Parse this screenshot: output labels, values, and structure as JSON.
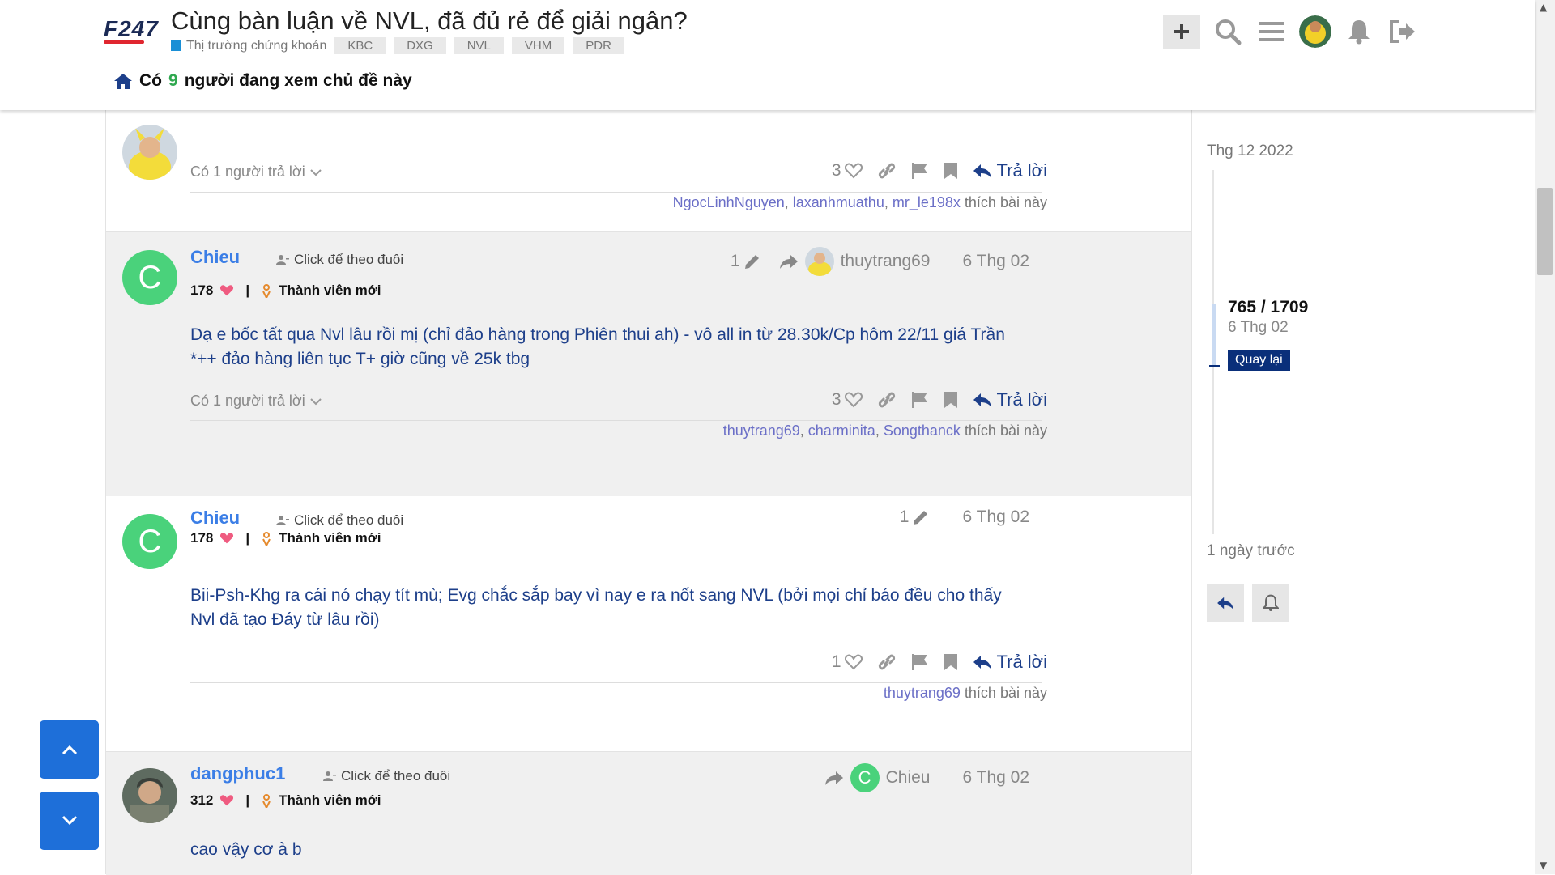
{
  "header": {
    "logo": "F247",
    "title": "Cùng bàn luận về NVL, đã đủ rẻ để giải ngân?",
    "category": "Thị trường chứng khoán",
    "tags": [
      "KBC",
      "DXG",
      "NVL",
      "VHM",
      "PDR"
    ],
    "viewers_prefix": "Có",
    "viewers_count": "9",
    "viewers_suffix": "người đang xem chủ đề này"
  },
  "posts": [
    {
      "replies": "Có 1 người trả lời",
      "likes": "3",
      "reply_label": "Trả lời",
      "likers": [
        "NgocLinhNguyen",
        "laxanhmuathu",
        "mr_le198x"
      ],
      "likers_suffix": "thích bài này"
    },
    {
      "username": "Chieu",
      "avatar_letter": "C",
      "follow": "Click để theo đuôi",
      "score": "178",
      "rank": "Thành viên mới",
      "edits": "1",
      "reply_to": "thuytrang69",
      "date": "6 Thg 02",
      "content": "Dạ e bốc tất qua Nvl lâu rồi mị (chỉ đảo hàng trong Phiên thui ah) - vô all in từ 28.30k/Cp hôm 22/11 giá Trần *++ đảo hàng liên tục T+ giờ cũng về 25k tbg",
      "replies": "Có 1 người trả lời",
      "likes": "3",
      "reply_label": "Trả lời",
      "likers": [
        "thuytrang69",
        "charminita",
        "Songthanck"
      ],
      "likers_suffix": "thích bài này"
    },
    {
      "username": "Chieu",
      "avatar_letter": "C",
      "follow": "Click để theo đuôi",
      "score": "178",
      "rank": "Thành viên mới",
      "edits": "1",
      "date": "6 Thg 02",
      "content": "Bii-Psh-Khg ra cái nó chạy tít mù; Evg chắc sắp bay vì nay e ra nốt sang NVL (bởi mọi chỉ báo đều cho thấy Nvl đã tạo Đáy từ lâu rồi)",
      "likes": "1",
      "reply_label": "Trả lời",
      "likers": [
        "thuytrang69"
      ],
      "likers_suffix": "thích bài này"
    },
    {
      "username": "dangphuc1",
      "follow": "Click để theo đuôi",
      "score": "312",
      "rank": "Thành viên mới",
      "reply_to": "Chieu",
      "reply_to_letter": "C",
      "date": "6 Thg 02",
      "content": "cao vậy cơ à b"
    }
  ],
  "timeline": {
    "top_date": "Thg 12 2022",
    "position": "765 / 1709",
    "current_date": "6 Thg 02",
    "back_label": "Quay lại",
    "bottom_label": "1 ngày trước"
  },
  "colors": {
    "username": "#3b7ee6",
    "content": "#1d3f8a",
    "category": "#1a8fd6",
    "letter_avatar": "#4ad27b",
    "float_button": "#1e6fd9",
    "timeline_button": "#0a2f7a"
  }
}
